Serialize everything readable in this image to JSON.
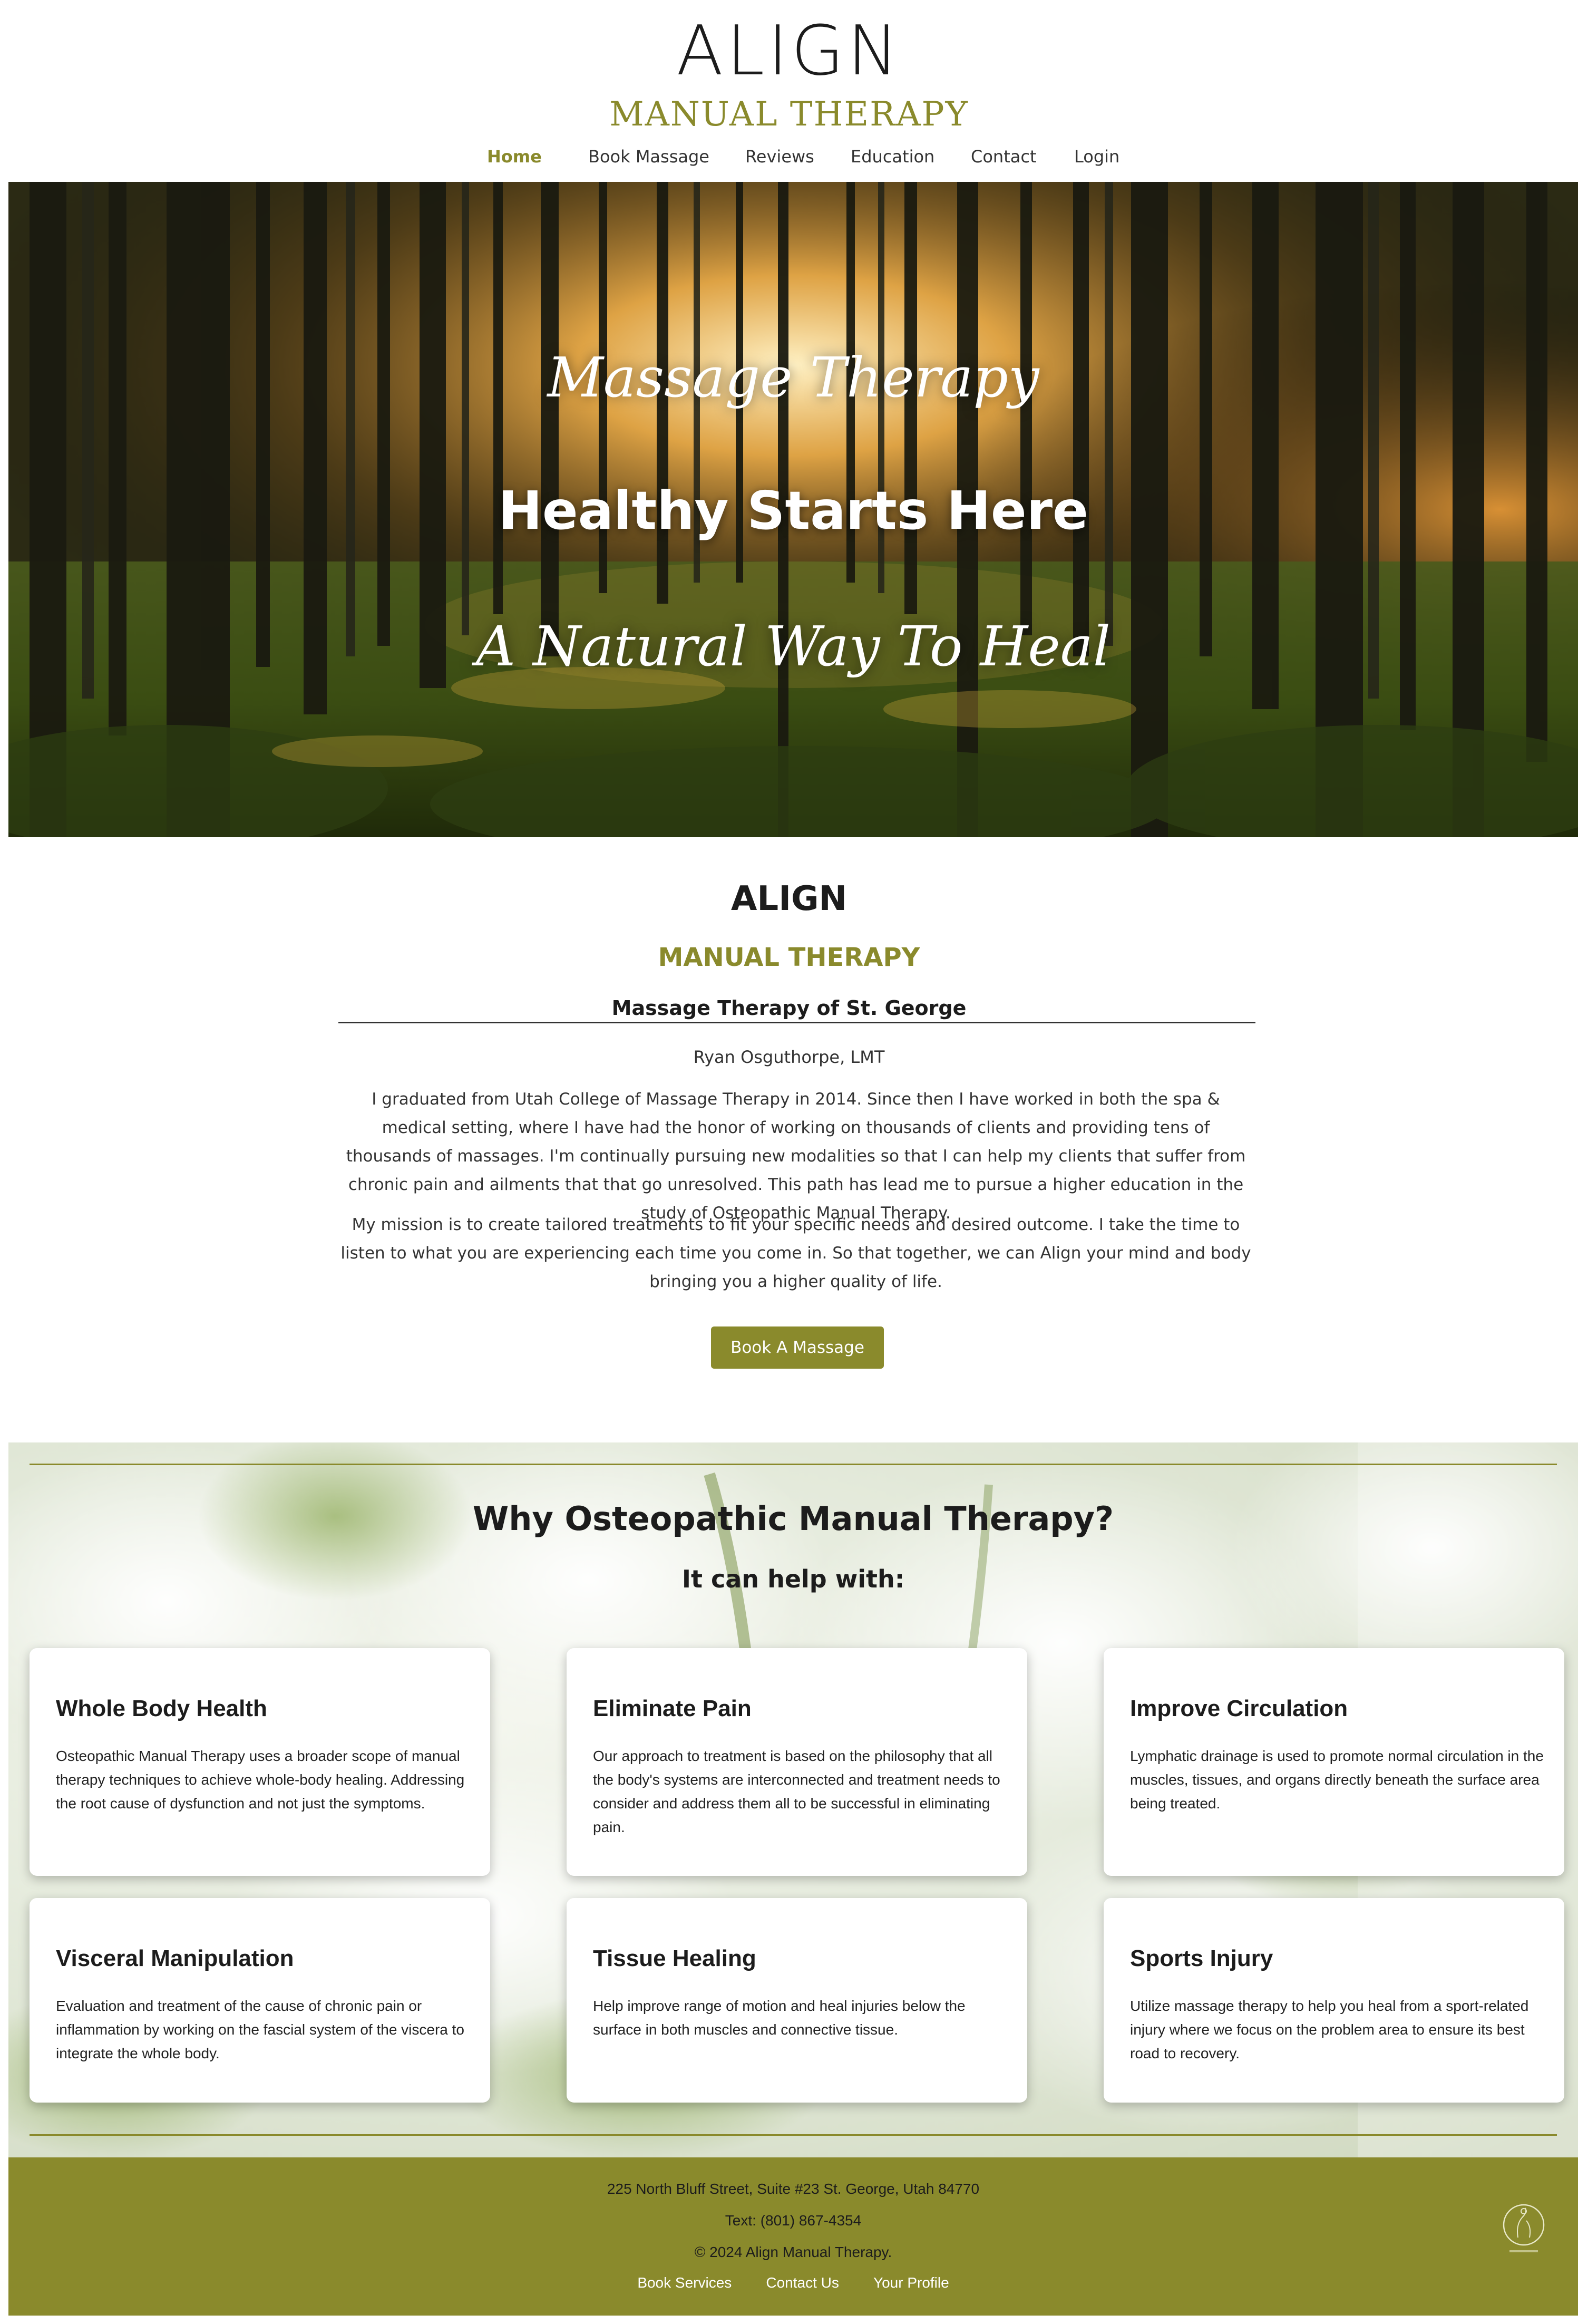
{
  "brand": {
    "name": "ALIGN",
    "subtitle": "MANUAL THERAPY",
    "accent_color": "#8a8a2c"
  },
  "nav": {
    "items": [
      {
        "label": "Home",
        "active": true
      },
      {
        "label": "Book Massage",
        "active": false
      },
      {
        "label": "Reviews",
        "active": false
      },
      {
        "label": "Education",
        "active": false
      },
      {
        "label": "Contact",
        "active": false
      },
      {
        "label": "Login",
        "active": false
      }
    ]
  },
  "hero": {
    "script_top": "Massage Therapy",
    "title": "Healthy Starts Here",
    "script_bottom": "A Natural Way To Heal"
  },
  "about": {
    "title": "ALIGN",
    "subtitle": "MANUAL THERAPY",
    "location": "Massage Therapy of St. George",
    "name": "Ryan Osguthorpe, LMT",
    "paragraph1": "I graduated from Utah College of Massage Therapy in 2014. Since then I have worked in both the spa & medical setting, where I have had the honor of working on thousands of clients and providing tens of thousands of massages. I'm continually pursuing new modalities so that I can help my clients that suffer from chronic pain and ailments that that go unresolved. This path has lead me to pursue a higher education in the study of Osteopathic Manual Therapy.",
    "paragraph2": "My mission is to create tailored treatments to fit your specific needs and desired outcome. I take the time to listen to what you are experiencing each time you come in. So that together, we can Align your mind and body bringing you a higher quality of life.",
    "button_label": "Book A Massage"
  },
  "why": {
    "title": "Why Osteopathic Manual Therapy?",
    "subtitle": "It can help with:",
    "cards": [
      {
        "title": "Whole Body Health",
        "body": "Osteopathic Manual Therapy uses a broader scope of manual therapy techniques to achieve whole-body healing. Addressing the root cause of dysfunction and not just the symptoms."
      },
      {
        "title": "Eliminate Pain",
        "body": "Our approach to treatment is based on the philosophy that all the body's systems are interconnected and treatment needs to consider and address them all to be successful in eliminating pain."
      },
      {
        "title": "Improve Circulation",
        "body": "Lymphatic drainage is used to promote normal circulation in the muscles, tissues, and organs directly beneath the surface area being treated."
      },
      {
        "title": "Visceral Manipulation",
        "body": "Evaluation and treatment of the cause of chronic pain or inflammation by working on the fascial system of the viscera to integrate the whole body."
      },
      {
        "title": "Tissue Healing",
        "body": "Help improve range of motion and heal injuries below the surface in both muscles and connective tissue."
      },
      {
        "title": "Sports Injury",
        "body": "Utilize massage therapy to help you heal from a sport-related injury where we focus on the problem area to ensure its best road to recovery."
      }
    ]
  },
  "footer": {
    "address": "225 North Bluff Street, Suite #23 St. George, Utah 84770",
    "phone": "Text: (801) 867-4354",
    "copyright": "© 2024 Align Manual Therapy.",
    "links": [
      "Book Services",
      "Contact Us",
      "Your Profile"
    ]
  }
}
